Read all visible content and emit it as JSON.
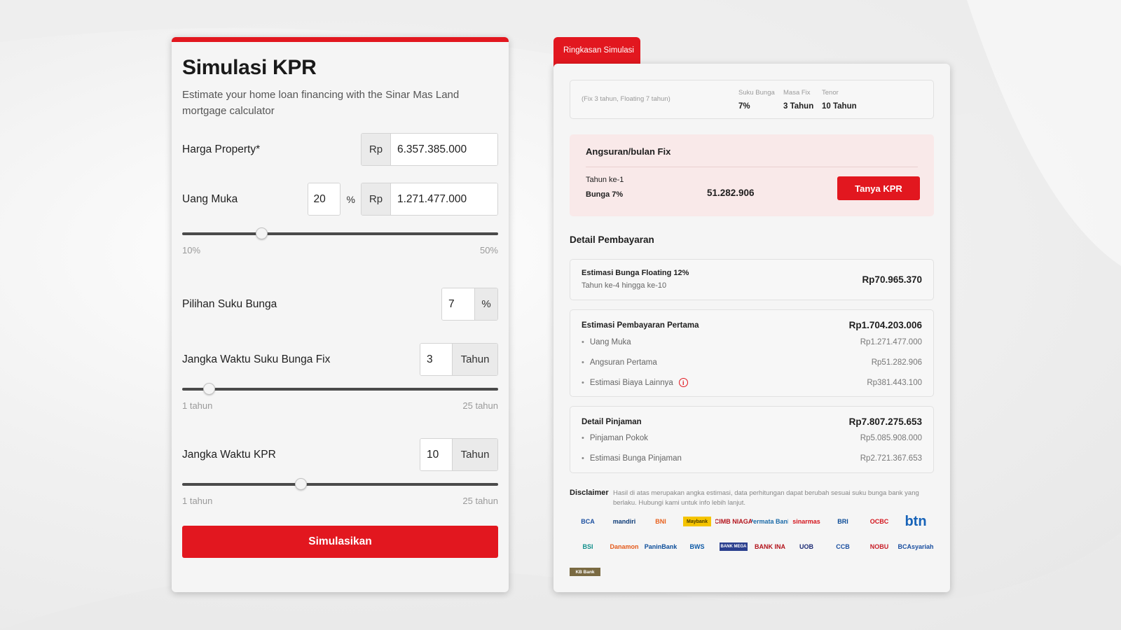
{
  "calculator": {
    "title": "Simulasi KPR",
    "subtitle": "Estimate your home loan financing with the Sinar Mas Land mortgage calculator",
    "property_price": {
      "label": "Harga Property*",
      "currency": "Rp",
      "value": "6.357.385.000"
    },
    "down_payment": {
      "label": "Uang Muka",
      "percent_value": "20",
      "percent_sign": "%",
      "currency": "Rp",
      "value": "1.271.477.000",
      "slider": {
        "min_label": "10%",
        "max_label": "50%",
        "min": 10,
        "max": 50,
        "value": 20
      }
    },
    "interest_rate": {
      "label": "Pilihan Suku Bunga",
      "value": "7",
      "unit": "%"
    },
    "fixed_period": {
      "label": "Jangka Waktu Suku Bunga Fix",
      "value": "3",
      "unit": "Tahun",
      "slider": {
        "min_label": "1 tahun",
        "max_label": "25 tahun",
        "min": 1,
        "max": 25,
        "value": 3
      }
    },
    "loan_term": {
      "label": "Jangka Waktu KPR",
      "value": "10",
      "unit": "Tahun",
      "slider": {
        "min_label": "1 tahun",
        "max_label": "25 tahun",
        "min": 1,
        "max": 25,
        "value": 10
      }
    },
    "submit_label": "Simulasikan"
  },
  "summary": {
    "tab_label": "Ringkasan Simulasi",
    "overview": {
      "scheme": "(Fix 3 tahun, Floating 7 tahun)",
      "rate_label": "Suku Bunga",
      "rate_value": "7%",
      "fixed_label": "Masa Fix",
      "fixed_value": "3 Tahun",
      "tenor_label": "Tenor",
      "tenor_value": "10 Tahun"
    },
    "installment": {
      "title": "Angsuran/bulan Fix",
      "year_label": "Tahun ke-1",
      "rate_label": "Bunga 7%",
      "amount": "51.282.906",
      "button_label": "Tanya KPR"
    },
    "detail_title": "Detail Pembayaran",
    "floating": {
      "label": "Estimasi Bunga Floating 12%",
      "sub": "Tahun ke-4 hingga ke-10",
      "value": "Rp70.965.370"
    },
    "first_payment": {
      "label": "Estimasi Pembayaran Pertama",
      "total": "Rp1.704.203.006",
      "items": [
        {
          "label": "Uang Muka",
          "value": "Rp1.271.477.000"
        },
        {
          "label": "Angsuran Pertama",
          "value": "Rp51.282.906"
        },
        {
          "label": "Estimasi Biaya Lainnya",
          "value": "Rp381.443.100"
        }
      ]
    },
    "loan_detail": {
      "label": "Detail Pinjaman",
      "total": "Rp7.807.275.653",
      "items": [
        {
          "label": "Pinjaman Pokok",
          "value": "Rp5.085.908.000"
        },
        {
          "label": "Estimasi Bunga Pinjaman",
          "value": "Rp2.721.367.653"
        }
      ]
    },
    "disclaimer": {
      "label": "Disclaimer",
      "text": "Hasil di atas merupakan angka estimasi, data perhitungan dapat berubah sesuai suku bunga bank yang berlaku. Hubungi kami untuk info lebih lanjut."
    },
    "banks": [
      {
        "name": "BCA",
        "color": "#1a4fa0"
      },
      {
        "name": "mandiri",
        "color": "#0d3c78"
      },
      {
        "name": "BNI",
        "color": "#e8601c"
      },
      {
        "name": "Maybank",
        "color": "#b08a00"
      },
      {
        "name": "CIMB NIAGA",
        "color": "#b3131b"
      },
      {
        "name": "Permata Bank",
        "color": "#1a6aa8"
      },
      {
        "name": "sinarmas",
        "color": "#d4141c"
      },
      {
        "name": "BRI",
        "color": "#0a4a96"
      },
      {
        "name": "OCBC",
        "color": "#d4141c"
      },
      {
        "name": "btn",
        "color": "#1763b8"
      },
      {
        "name": "BSI",
        "color": "#0f8e8a"
      },
      {
        "name": "Danamon",
        "color": "#e45a1b"
      },
      {
        "name": "PaninBank",
        "color": "#0d4e9a"
      },
      {
        "name": "BWS",
        "color": "#0d5aa7"
      },
      {
        "name": "BANK MEGA",
        "color": "#2a3f8e"
      },
      {
        "name": "BANK INA",
        "color": "#b3131b"
      },
      {
        "name": "UOB",
        "color": "#1b2a74"
      },
      {
        "name": "CCB",
        "color": "#1a4fa0"
      },
      {
        "name": "NOBU",
        "color": "#c81d27"
      },
      {
        "name": "BCAsyariah",
        "color": "#1a4fa0"
      },
      {
        "name": "KB Bank",
        "color": "#7a6a42"
      }
    ]
  }
}
